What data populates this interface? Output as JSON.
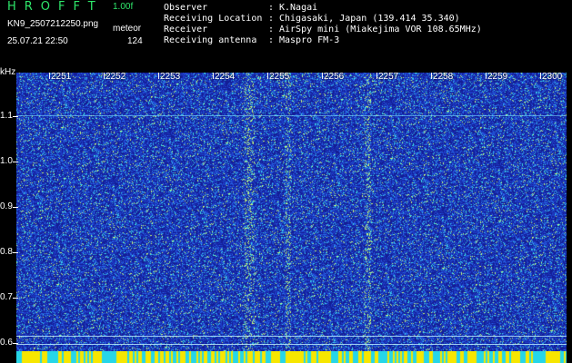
{
  "header": {
    "app_title": "HROFFT",
    "version": "1.00f",
    "filename": "KN9_2507212250.png",
    "mode": "meteor",
    "timestamp": "25.07.21 22:50",
    "count": "124",
    "meta": [
      {
        "label": "Observer",
        "value": "K.Nagai"
      },
      {
        "label": "Receiving Location",
        "value": "Chigasaki, Japan (139.414 35.340)"
      },
      {
        "label": "Receiver",
        "value": "AirSpy mini (Miakejima VOR 108.65MHz)"
      },
      {
        "label": "Receiving antenna",
        "value": "Maspro FM-3"
      }
    ],
    "separator": ":"
  },
  "axes": {
    "y_unit": "kHz",
    "x_labels": [
      "2251",
      "2252",
      "2253",
      "2254",
      "2255",
      "2256",
      "2257",
      "2258",
      "2259",
      "2300"
    ],
    "y_labels": [
      "1.1",
      "1.0",
      "0.9",
      "0.8",
      "0.7",
      "0.6"
    ]
  },
  "colors": {
    "background": "#000000",
    "plot_base": "#1f35b8",
    "title_green": "#2ee66a",
    "bar_yellow": "#f7e600",
    "bar_cyan": "#26d6e8"
  }
}
